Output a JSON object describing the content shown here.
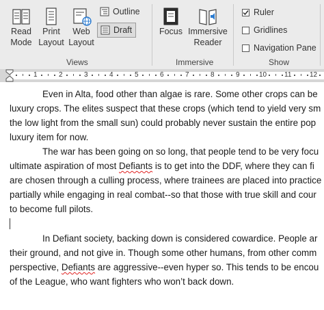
{
  "ribbon": {
    "views": {
      "read_mode": [
        "Read",
        "Mode"
      ],
      "print_layout": [
        "Print",
        "Layout"
      ],
      "web_layout": [
        "Web",
        "Layout"
      ],
      "outline": "Outline",
      "draft": "Draft",
      "group_name": "Views"
    },
    "immersive": {
      "focus": "Focus",
      "immersive_reader": [
        "Immersive",
        "Reader"
      ],
      "group_name": "Immersive"
    },
    "show": {
      "ruler": "Ruler",
      "ruler_checked": true,
      "gridlines": "Gridlines",
      "gridlines_checked": false,
      "navigation_pane": "Navigation Pane",
      "navigation_pane_checked": false,
      "group_name": "Show"
    }
  },
  "ruler": {
    "numbers": [
      "1",
      "2",
      "3",
      "4",
      "5",
      "6",
      "7",
      "8",
      "9",
      "10",
      "11",
      "12"
    ]
  },
  "document": {
    "p1": [
      "Even in Alta, food other than algae is rare.  Some other crops can be",
      "luxury crops.  The elites suspect that these crops (which tend to yield very sm",
      "the low light from the small sun) could probably never sustain the entire pop",
      "luxury item for now."
    ],
    "p2_l1": "The war has been going on so long, that people tend to be very focu",
    "p2_l2_a": "ultimate aspiration of most ",
    "p2_l2_word": "Defiants",
    "p2_l2_b": " is to get into the DDF, where they can fi",
    "p2_rest": [
      "are chosen through a culling process, where trainees are placed into practice",
      "partially while engaging in real combat--so that those with true skill and cour",
      "to become full pilots."
    ],
    "p3": [
      "In Defiant society, backing down is considered cowardice.  People ar",
      "their ground, and not give in.  Though some other humans, from other comm"
    ],
    "p3_l3_a": "perspective, ",
    "p3_l3_word": "Defiants",
    "p3_l3_b": " are aggressive--even hyper so.  This tends to be encou",
    "p3_l4": "of the League, who want fighters who won’t back down."
  },
  "colors": {
    "ribbon_bg": "#ebebeb",
    "ruler_bg": "#d6d6d6",
    "spell_underline": "#e02020",
    "globe_blue": "#2b7bd0"
  }
}
